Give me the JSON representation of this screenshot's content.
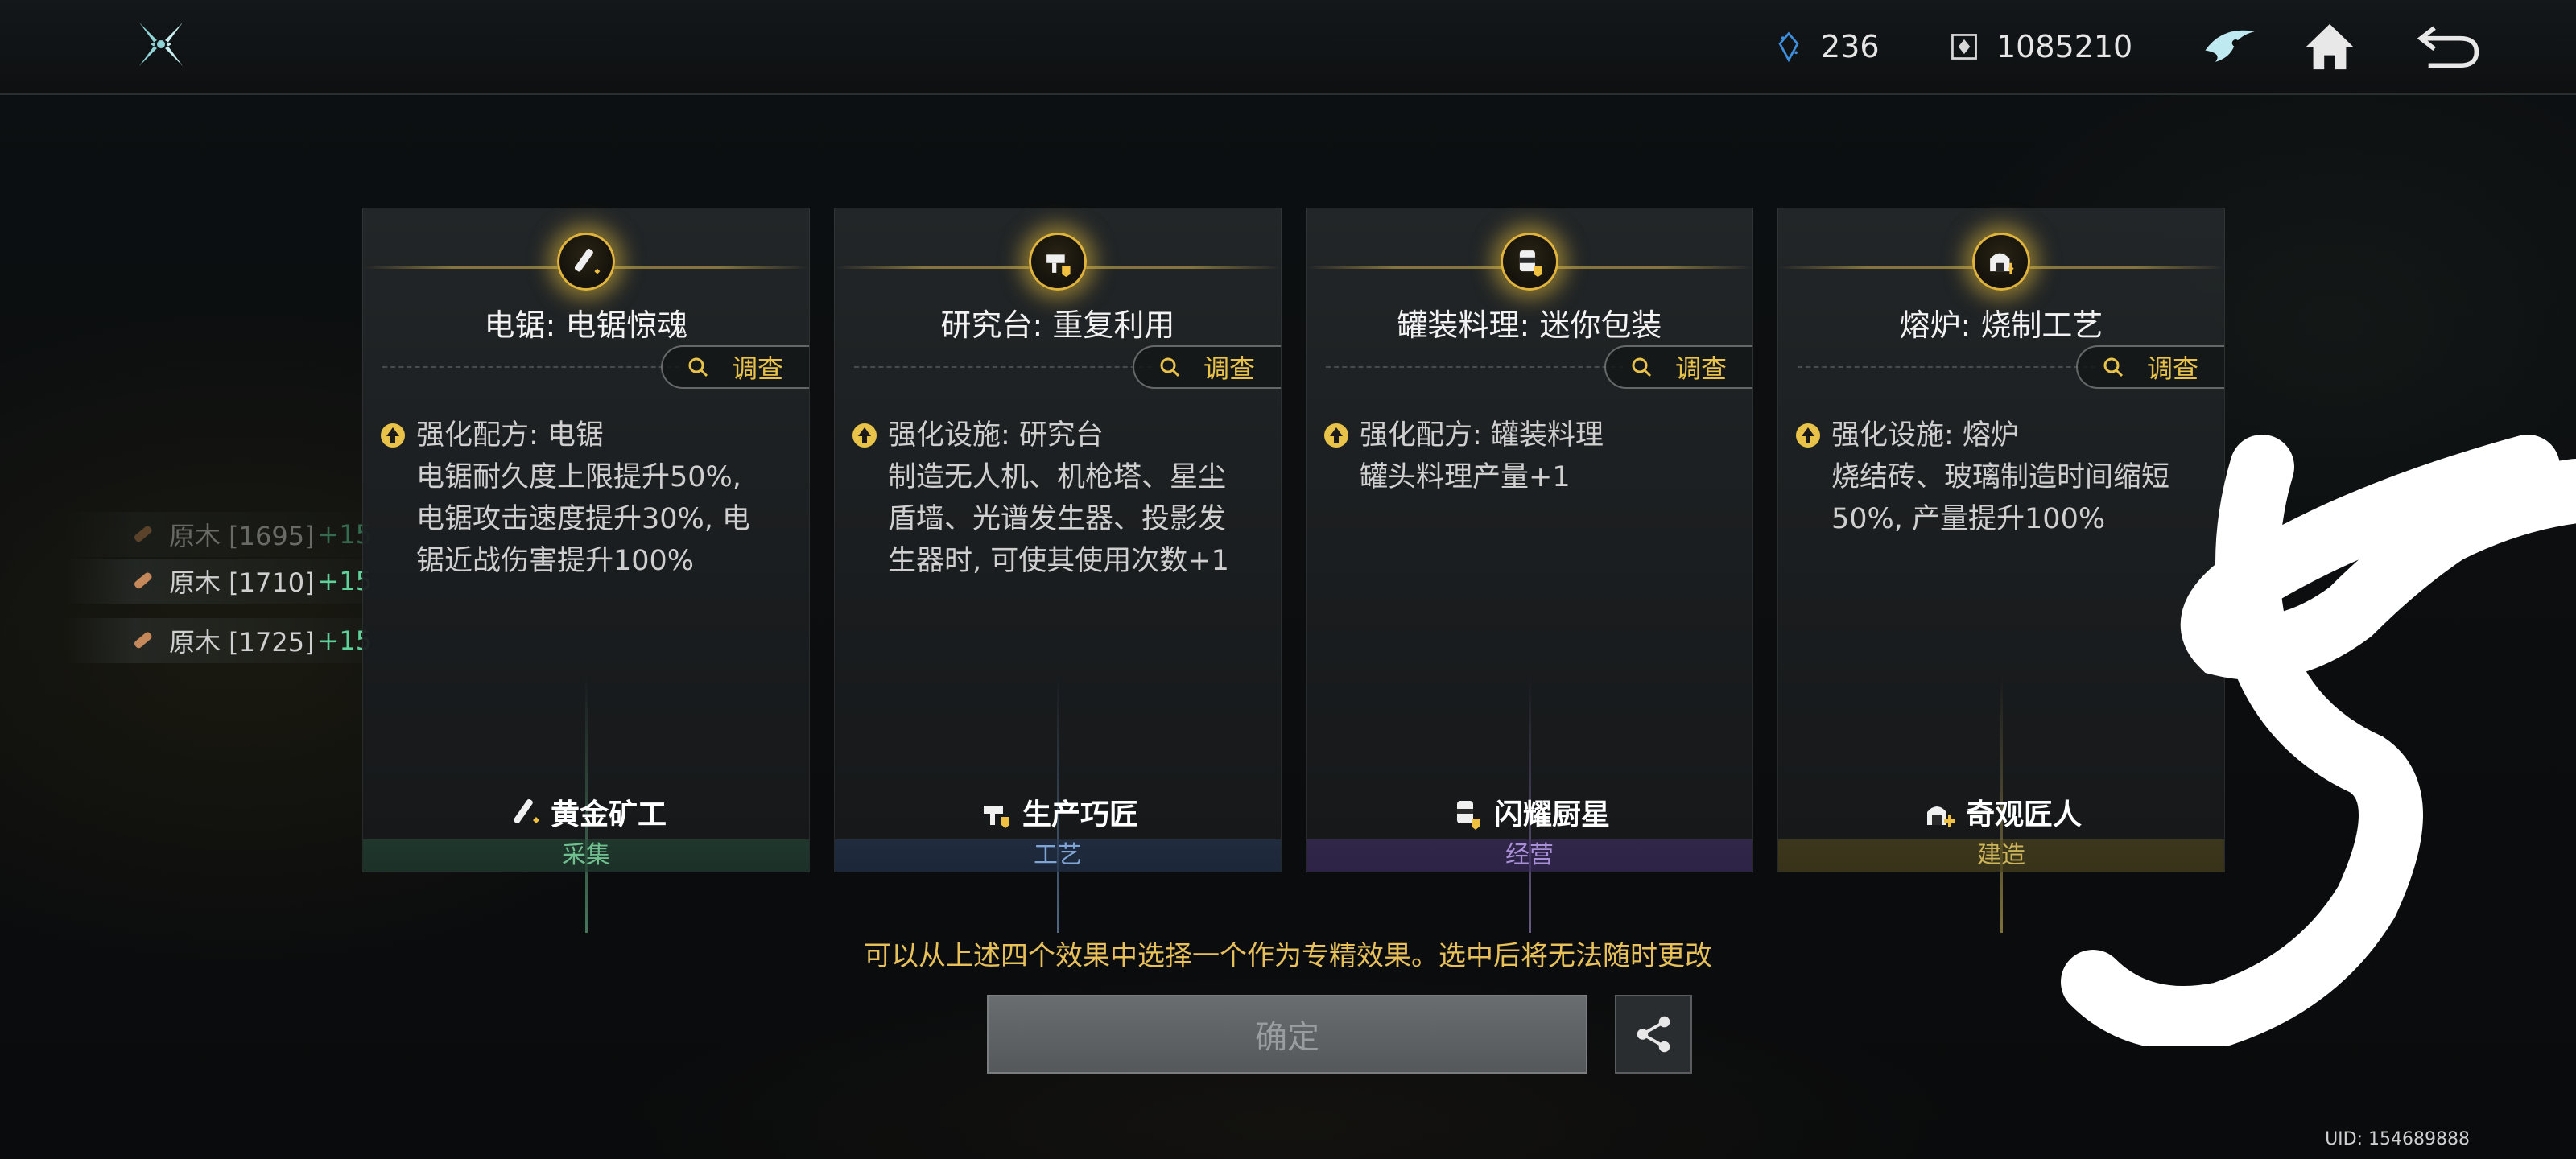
{
  "topbar": {
    "crystal_count": "236",
    "coin_count": "1085210",
    "icons": [
      "game-logo-icon",
      "crystal-icon",
      "coin-icon",
      "ai-assistant-icon",
      "home-icon",
      "back-icon"
    ]
  },
  "side_list": {
    "items": [
      {
        "name": "原木 [1695]",
        "bonus": "+15"
      },
      {
        "name": "原木 [1710]",
        "bonus": "+15"
      },
      {
        "name": "原木 [1725]",
        "bonus": "+15"
      }
    ]
  },
  "cards": [
    {
      "title": "电锯: 电锯惊魂",
      "inspect_label": "调查",
      "effect_head": "强化配方: 电锯",
      "effect_lines": [
        "电锯耐久度上限提升50%,",
        "电锯攻击速度提升30%, 电",
        "锯近战伤害提升100%",
        ""
      ],
      "tier": "黄金矿工",
      "category": "采集",
      "accent": "#6fbf8f"
    },
    {
      "title": "研究台: 重复利用",
      "inspect_label": "调查",
      "effect_head": "强化设施: 研究台",
      "effect_lines": [
        "制造无人机、机枪塔、星尘",
        "盾墙、光谱发生器、投影发",
        "生器时, 可使其使用次数+1",
        ""
      ],
      "tier": "生产巧匠",
      "category": "工艺",
      "accent": "#7fa5d6"
    },
    {
      "title": "罐装料理: 迷你包装",
      "inspect_label": "调查",
      "effect_head": "强化配方: 罐装料理",
      "effect_lines": [
        "罐头料理产量+1",
        "",
        "",
        ""
      ],
      "tier": "闪耀厨星",
      "category": "经营",
      "accent": "#a88fd8"
    },
    {
      "title": "熔炉: 烧制工艺",
      "inspect_label": "调查",
      "effect_head": "强化设施: 熔炉",
      "effect_lines": [
        "烧结砖、玻璃制造时间缩短",
        "50%, 产量提升100%",
        "",
        ""
      ],
      "tier": "奇观匠人",
      "category": "建造",
      "accent": "#cdb45a"
    }
  ],
  "notice": "可以从上述四个效果中选择一个作为专精效果。选中后将无法随时更改",
  "confirm_label": "确定",
  "uid": "UID: 154689888",
  "colors": {
    "gold": "#e8c05a",
    "background": "#0c0e10"
  }
}
